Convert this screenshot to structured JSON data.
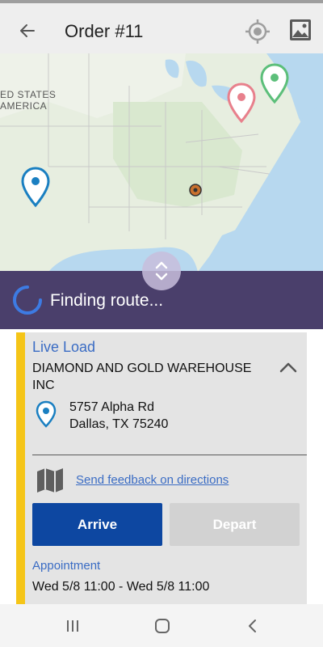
{
  "header": {
    "title": "Order #11",
    "back_icon": "arrow-left-icon",
    "locate_icon": "crosshair-icon",
    "image_icon": "image-icon"
  },
  "map": {
    "region_label_line1": "ED STATES",
    "region_label_line2": "AMERICA",
    "markers": [
      {
        "name": "origin",
        "color": "#1a7fc1"
      },
      {
        "name": "pickup",
        "color": "#e8808c"
      },
      {
        "name": "destination",
        "color": "#5cbf7a"
      },
      {
        "name": "current-location",
        "color": "#c9712e"
      }
    ]
  },
  "route_banner": {
    "text": "Finding route..."
  },
  "stop": {
    "load_type": "Live Load",
    "company": "DIAMOND AND GOLD WAREHOUSE INC",
    "address_line1": "5757 Alpha Rd",
    "address_line2": "Dallas, TX 75240",
    "feedback_link": "Send feedback on directions",
    "arrive_label": "Arrive",
    "depart_label": "Depart",
    "appointment_label": "Appointment",
    "appointment_value": "Wed 5/8 11:00 - Wed 5/8 11:00"
  },
  "colors": {
    "accent": "#f5c518",
    "primary": "#0d47a1",
    "link": "#3a6cc4",
    "banner": "#4a3f6b"
  }
}
